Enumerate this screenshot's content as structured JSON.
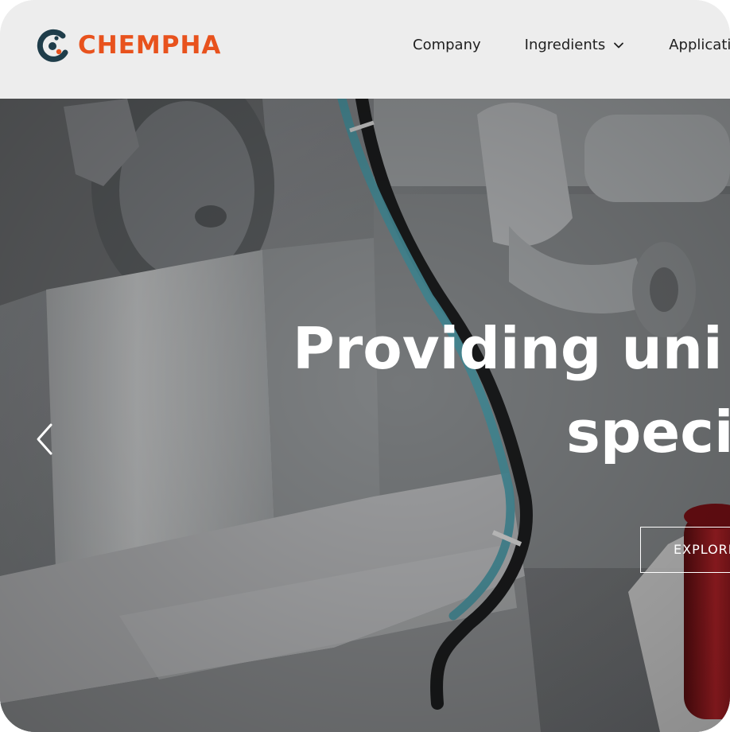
{
  "header": {
    "logo": {
      "text": "CHEMPHA",
      "brand_color": "#e8521d",
      "mark_color": "#1f3d4a",
      "icon": "chempha-logo-icon"
    },
    "nav": [
      {
        "label": "Company"
      },
      {
        "label": "Ingredients",
        "icon": "chevron-down-icon"
      },
      {
        "label": "Applicatio"
      }
    ]
  },
  "hero": {
    "title_line1": "Providing uni",
    "title_line2": "speci",
    "cta_label": "EXPLORE",
    "prev_icon": "chevron-left-icon",
    "image": "industrial-machine-hero-photo"
  }
}
